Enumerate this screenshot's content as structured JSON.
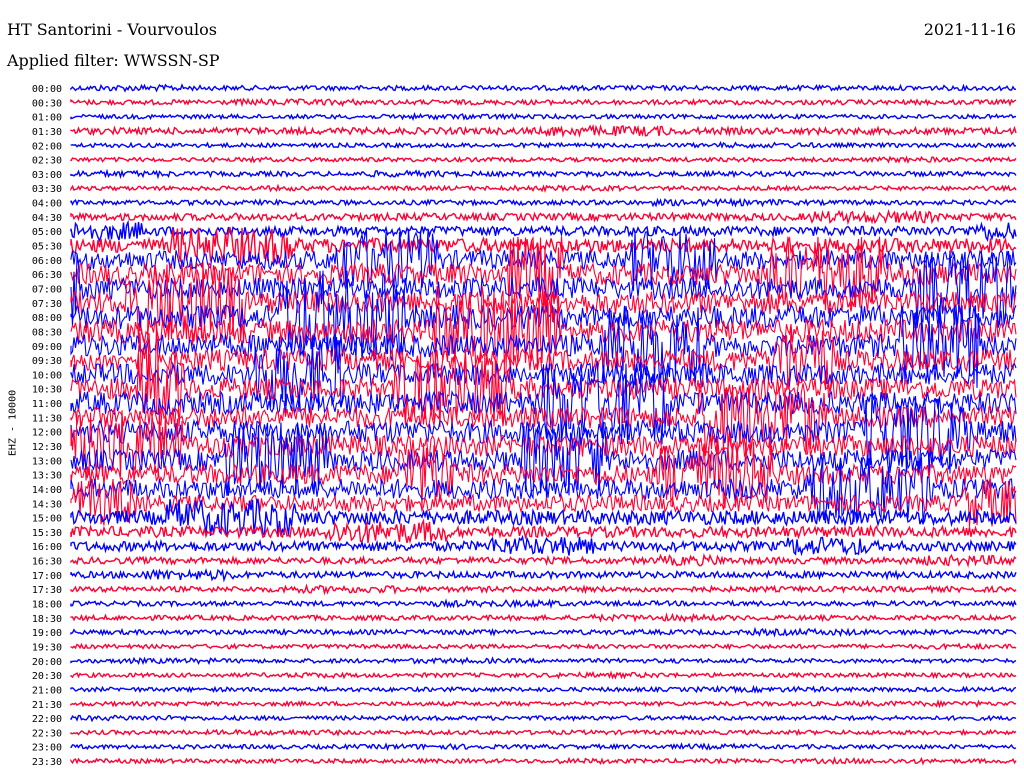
{
  "header": {
    "station": "HT Santorini - Vourvoulos",
    "date": "2021-11-16",
    "filter": "Applied filter: WWSSN-SP"
  },
  "chart_data": {
    "type": "seismogram",
    "title": "HT Santorini - Vourvoulos",
    "date": "2021-11-16",
    "filter": "WWSSN-SP",
    "ylabel": "EHZ - 10000",
    "row_labels": [
      "00:00",
      "00:30",
      "01:00",
      "01:30",
      "02:00",
      "02:30",
      "03:00",
      "03:30",
      "04:00",
      "04:30",
      "05:00",
      "05:30",
      "06:00",
      "06:30",
      "07:00",
      "07:30",
      "08:00",
      "08:30",
      "09:00",
      "09:30",
      "10:00",
      "10:30",
      "11:00",
      "11:30",
      "12:00",
      "12:30",
      "13:00",
      "13:30",
      "14:00",
      "14:30",
      "15:00",
      "15:30",
      "16:00",
      "16:30",
      "17:00",
      "17:30",
      "18:00",
      "18:30",
      "19:00",
      "19:30",
      "20:00",
      "20:30",
      "21:00",
      "21:30",
      "22:00",
      "22:30",
      "23:00",
      "23:30"
    ],
    "row_colors": [
      "#0000ff",
      "#ff0033"
    ],
    "activity_level": [
      0.2,
      0.2,
      0.15,
      0.35,
      0.15,
      0.15,
      0.2,
      0.15,
      0.2,
      0.4,
      0.6,
      1.0,
      1.4,
      1.6,
      1.6,
      1.7,
      1.8,
      1.8,
      1.7,
      1.6,
      1.6,
      1.6,
      1.7,
      1.6,
      1.7,
      1.6,
      1.6,
      1.5,
      1.5,
      1.2,
      1.0,
      0.7,
      0.6,
      0.35,
      0.35,
      0.25,
      0.2,
      0.2,
      0.2,
      0.15,
      0.15,
      0.15,
      0.15,
      0.15,
      0.15,
      0.15,
      0.15,
      0.15
    ],
    "grid": false,
    "legend": "none"
  }
}
